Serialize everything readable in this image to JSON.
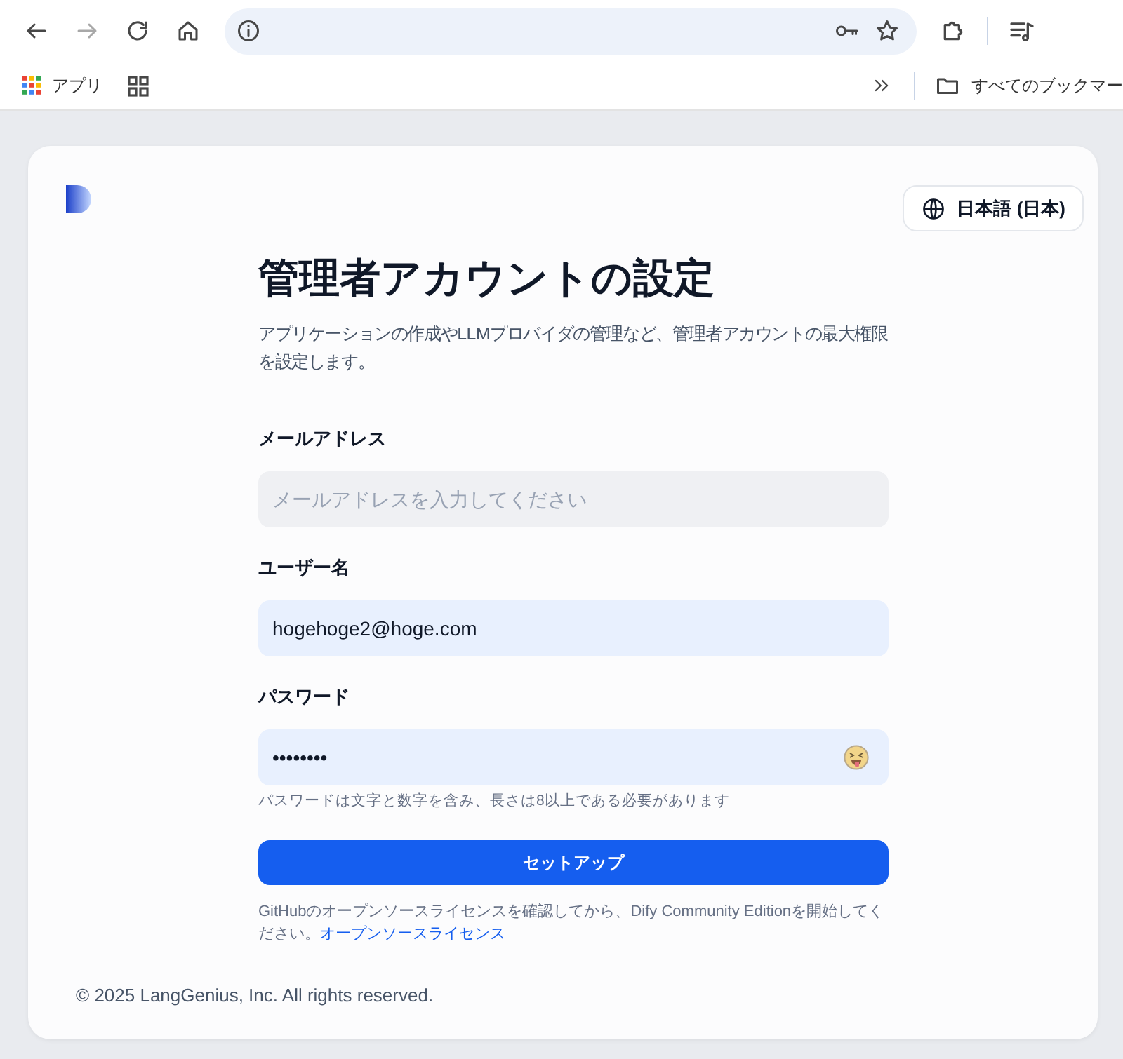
{
  "browser": {
    "bookmarks": [
      {
        "label": "アプリ"
      }
    ],
    "all_bookmarks": "すべてのブックマー"
  },
  "language_button": "日本語 (日本)",
  "title": "管理者アカウントの設定",
  "description": "アプリケーションの作成やLLMプロバイダの管理など、管理者アカウントの最大権限を設定します。",
  "fields": [
    {
      "kind": "email",
      "label": "メールアドレス",
      "placeholder": "メールアドレスを入力してください"
    },
    {
      "kind": "text",
      "label": "ユーザー名",
      "value": "hogehoge2@hoge.com"
    },
    {
      "kind": "password",
      "label": "パスワード",
      "value": "••••••••",
      "hint": "パスワードは文字と数字を含み、長さは8以上である必要があります"
    }
  ],
  "submit_button": "セットアップ",
  "license": {
    "text": "GitHubのオープンソースライセンスを確認してから、Dify Community Editionを開始してください。",
    "link": "オープンソースライセンス"
  },
  "footer": "© 2025 LangGenius, Inc. All rights reserved."
}
